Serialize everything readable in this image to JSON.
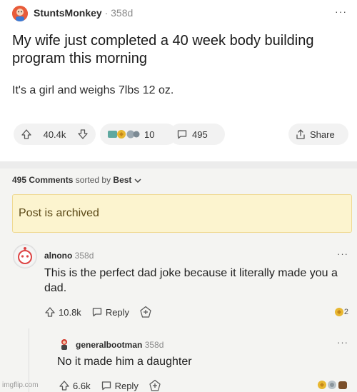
{
  "post": {
    "author": "StuntsMonkey",
    "separator": "·",
    "age": "358d",
    "more": "···",
    "title": "My wife just completed a 40 week body building program this morning",
    "body": "It's a girl and weighs 7lbs 12 oz.",
    "votes": "40.4k",
    "awards_count": "10",
    "comments": "495",
    "share_label": "Share"
  },
  "sort": {
    "count_label": "495 Comments",
    "sorted_by": "sorted by",
    "value": "Best"
  },
  "archived_notice": "Post is archived",
  "comments": [
    {
      "author": "alnono",
      "age": "358d",
      "more": "···",
      "text": "This is the perfect dad joke because it literally made you a dad.",
      "votes": "10.8k",
      "reply_label": "Reply",
      "award_count": "2"
    },
    {
      "author": "generalbootman",
      "age": "358d",
      "more": "···",
      "text": "No it made him a daughter",
      "votes": "6.6k",
      "reply_label": "Reply"
    }
  ],
  "watermark": "imgflip.com",
  "colors": {
    "archived_bg": "#fcf4cf",
    "archived_border": "#efd992",
    "avatar_orange": "#e85c3a",
    "award_gold": "#e8b731"
  }
}
